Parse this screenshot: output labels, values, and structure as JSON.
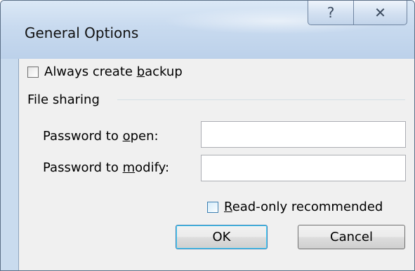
{
  "window": {
    "title": "General Options",
    "help_glyph": "?",
    "close_glyph": "✕"
  },
  "options": {
    "always_backup": {
      "before": "Always create ",
      "key": "b",
      "after": "ackup",
      "checked": false
    }
  },
  "file_sharing": {
    "label": "File sharing",
    "password_open": {
      "before": "Password to ",
      "key": "o",
      "after": "pen:",
      "value": ""
    },
    "password_modify": {
      "before": "Password to ",
      "key": "m",
      "after": "odify:",
      "value": ""
    },
    "read_only": {
      "key": "R",
      "after": "ead-only recommended",
      "checked": false
    }
  },
  "buttons": {
    "ok": "OK",
    "cancel": "Cancel"
  },
  "colors": {
    "titlebar": "#c8daef",
    "client": "#f0f0f0",
    "default_button_border": "#3c7fb1"
  }
}
